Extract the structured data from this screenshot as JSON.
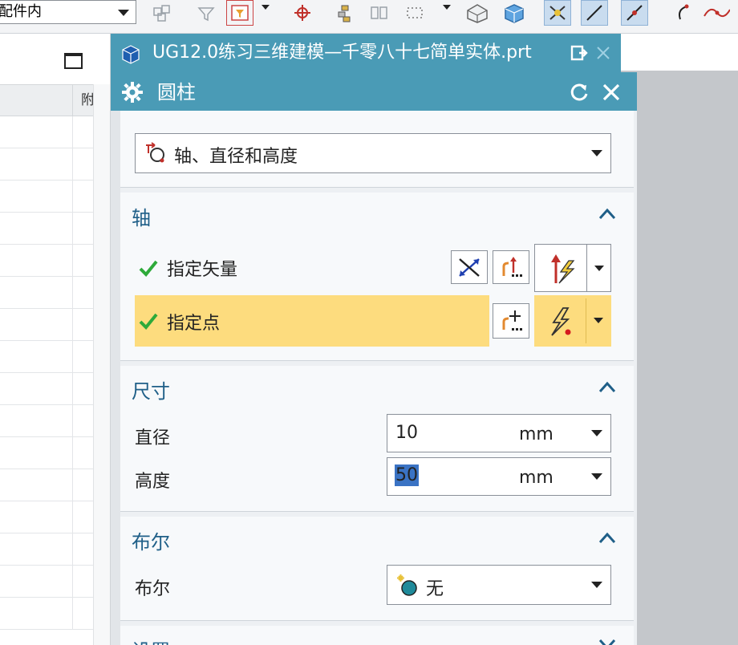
{
  "toolbar": {
    "filter_value": "整个装配件内",
    "icons": [
      "filter-icon",
      "type-filter-icon",
      "snap-point-icon",
      "assembly-icon",
      "view-icon",
      "dotted-select-icon",
      "solid-view-icon",
      "cube-icon",
      "snap-toggle-icon",
      "line-tool-icon",
      "curve-point-icon",
      "arc-icon",
      "spline-icon"
    ]
  },
  "navigator": {
    "header_col2": "附"
  },
  "doc_tab": {
    "title": "UG12.0练习三维建模—千零八十七简单实体.prt"
  },
  "dialog": {
    "title": "圆柱",
    "type_value": "轴、直径和高度",
    "axis": {
      "title": "轴",
      "vector_label": "指定矢量",
      "point_label": "指定点"
    },
    "dimensions": {
      "title": "尺寸",
      "diameter_label": "直径",
      "diameter_value": "10",
      "diameter_unit": "mm",
      "height_label": "高度",
      "height_value": "50",
      "height_unit": "mm"
    },
    "boolean": {
      "title": "布尔",
      "label": "布尔",
      "value": "无"
    },
    "settings": {
      "title": "设置"
    }
  },
  "colors": {
    "header_blue": "#4a9bb6",
    "group_title": "#1f5f88",
    "highlight_row": "#fddc7e",
    "check_green": "#2eaa3a"
  }
}
